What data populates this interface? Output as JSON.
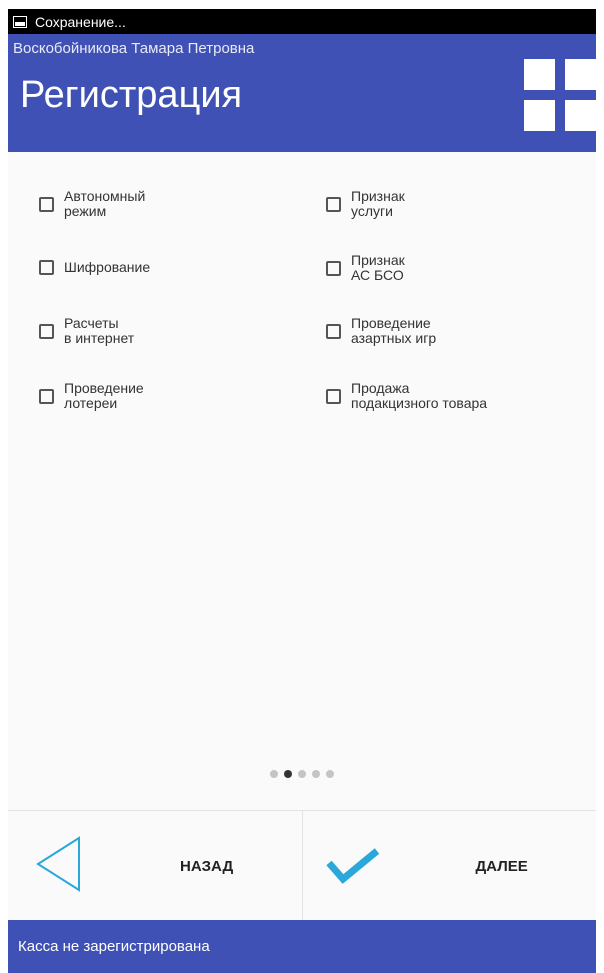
{
  "status_bar": {
    "text": "Сохранение..."
  },
  "header": {
    "user": "Воскобойникова Тамара Петровна",
    "title": "Регистрация"
  },
  "options": [
    {
      "label": "Автономный\nрежим",
      "checked": false
    },
    {
      "label": "Признак\nуслуги",
      "checked": false
    },
    {
      "label": "Шифрование",
      "checked": false
    },
    {
      "label": "Признак\nАС БСО",
      "checked": false
    },
    {
      "label": "Расчеты\nв интернет",
      "checked": false
    },
    {
      "label": "Проведение\nазартных игр",
      "checked": false
    },
    {
      "label": "Проведение\nлотереи",
      "checked": false
    },
    {
      "label": "Продажа\nподакцизного товара",
      "checked": false
    }
  ],
  "pager": {
    "pages": 5,
    "current": 2
  },
  "buttons": {
    "back_label": "НАЗАД",
    "next_label": "ДАЛЕЕ"
  },
  "footer": {
    "status": "Касса не зарегистрирована"
  },
  "colors": {
    "primary": "#3f51b5",
    "accent": "#29a8d9"
  }
}
